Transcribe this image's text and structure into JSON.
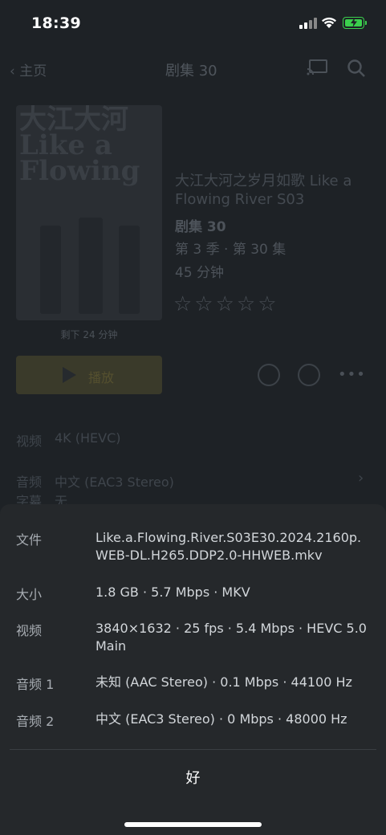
{
  "status_bar": {
    "time": "18:39"
  },
  "nav": {
    "back_label": "主页",
    "title": "剧集 30"
  },
  "poster": {
    "title_text": "大江大河 Like a Flowing",
    "remaining": "剩下 24 分钟"
  },
  "play": {
    "label": "播放"
  },
  "show": {
    "title": "大江大河之岁月如歌 Like a Flowing River S03",
    "episode": "剧集 30",
    "meta": "第 3 季 · 第 30 集",
    "duration": "45 分钟",
    "stars": "☆☆☆☆☆"
  },
  "bg_rows": [
    {
      "label": "视频",
      "value": "4K (HEVC)"
    },
    {
      "label": "音频",
      "value": "中文 (EAC3 Stereo)"
    },
    {
      "label": "字幕",
      "value": "无"
    }
  ],
  "sheet": {
    "rows": [
      {
        "label": "文件",
        "value": "Like.a.Flowing.River.S03E30.2024.2160p.WEB-DL.H265.DDP2.0-HHWEB.mkv"
      },
      {
        "label": "大小",
        "value": "1.8 GB · 5.7 Mbps · MKV"
      },
      {
        "label": "视频",
        "value": "3840×1632 · 25 fps · 5.4 Mbps · HEVC 5.0 Main"
      },
      {
        "label": "音频 1",
        "value": "未知 (AAC Stereo) · 0.1 Mbps · 44100 Hz"
      },
      {
        "label": "音频 2",
        "value": "中文 (EAC3 Stereo) · 0 Mbps · 48000 Hz"
      }
    ],
    "ok_label": "好"
  },
  "colors": {
    "battery": "#3bd04d",
    "sheet_bg": "#25282b"
  }
}
